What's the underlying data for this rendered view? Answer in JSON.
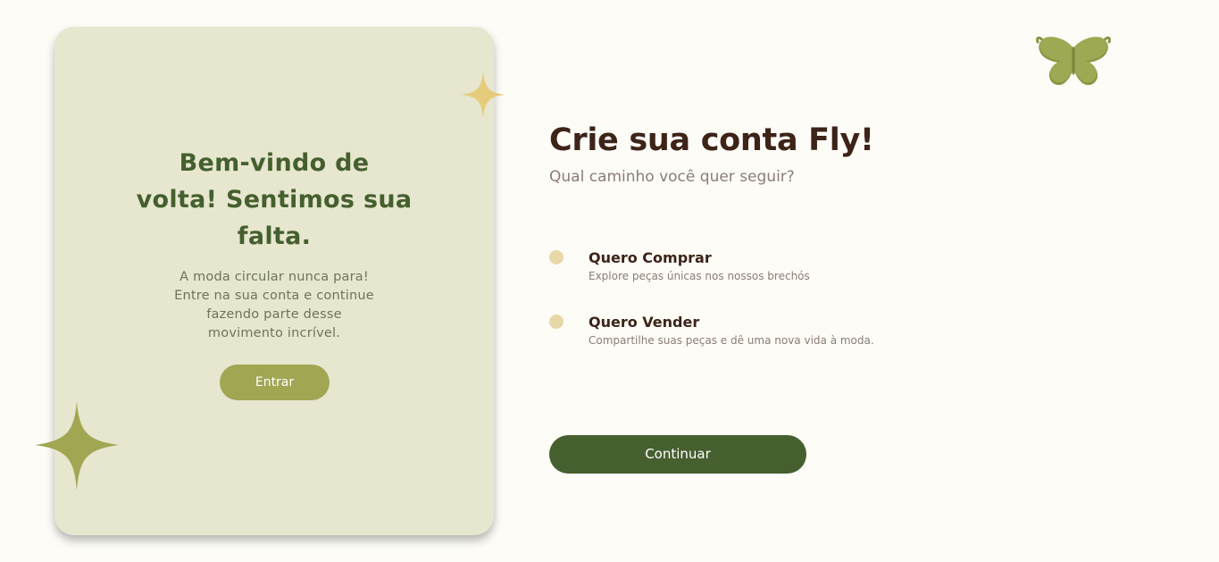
{
  "welcome": {
    "title_lines": [
      "Bem-vindo de",
      "volta! Sentimos sua",
      "falta."
    ],
    "text_lines": [
      "A moda circular nunca para!",
      "Entre na sua conta e continue",
      "fazendo parte desse",
      "movimento incrível."
    ],
    "login_button": "Entrar"
  },
  "signup": {
    "heading": "Crie sua conta Fly!",
    "subheading": "Qual caminho você quer seguir?",
    "options": [
      {
        "title": "Quero Comprar",
        "description": "Explore peças únicas nos nossos brechós"
      },
      {
        "title": "Quero Vender",
        "description": "Compartilhe suas peças e dê uma nova vida à moda."
      }
    ],
    "continue_button": "Continuar"
  },
  "icons": {
    "logo": "butterfly-icon",
    "decoration_gold": "sparkle-icon",
    "decoration_olive": "sparkle-icon"
  },
  "colors": {
    "background": "#fdfcf7",
    "card": "#e7e7cf",
    "title_green": "#455f2f",
    "olive": "#a1a653",
    "gold": "#e6cb7a",
    "dark_text": "#3d2318",
    "muted_text": "#8b7c76",
    "radio": "#e8d8a8",
    "primary_button": "#465f2f"
  }
}
